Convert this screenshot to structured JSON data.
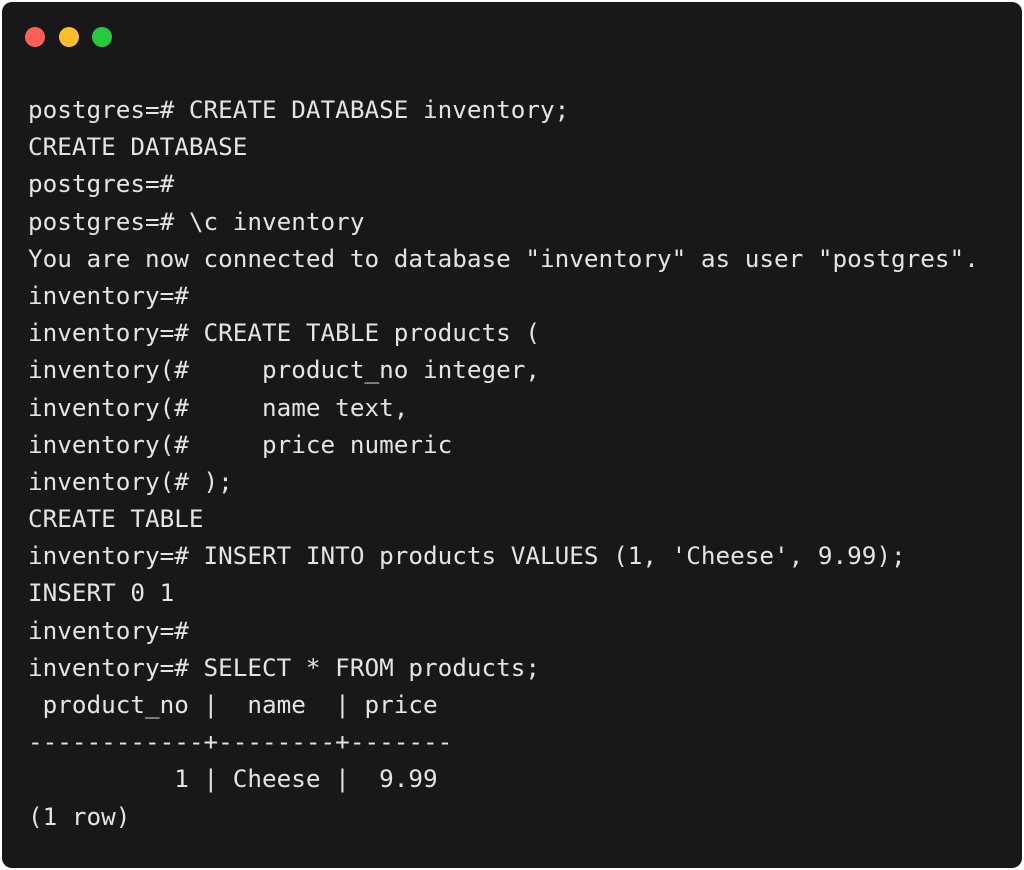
{
  "window": {
    "buttons": {
      "close": {
        "icon": "close-dot-icon",
        "color": "#ff5f56"
      },
      "minimize": {
        "icon": "minimize-dot-icon",
        "color": "#ffbd2e"
      },
      "maximize": {
        "icon": "maximize-dot-icon",
        "color": "#27c93f"
      }
    }
  },
  "terminal": {
    "text_color": "#e4e4e4",
    "background": "#18181a",
    "lines": [
      "postgres=# CREATE DATABASE inventory;",
      "CREATE DATABASE",
      "postgres=#",
      "postgres=# \\c inventory",
      "You are now connected to database \"inventory\" as user \"postgres\".",
      "inventory=#",
      "inventory=# CREATE TABLE products (",
      "inventory(#     product_no integer,",
      "inventory(#     name text,",
      "inventory(#     price numeric",
      "inventory(# );",
      "CREATE TABLE",
      "inventory=# INSERT INTO products VALUES (1, 'Cheese', 9.99);",
      "INSERT 0 1",
      "inventory=#",
      "inventory=# SELECT * FROM products;",
      " product_no |  name  | price",
      "------------+--------+-------",
      "          1 | Cheese |  9.99",
      "(1 row)"
    ]
  }
}
